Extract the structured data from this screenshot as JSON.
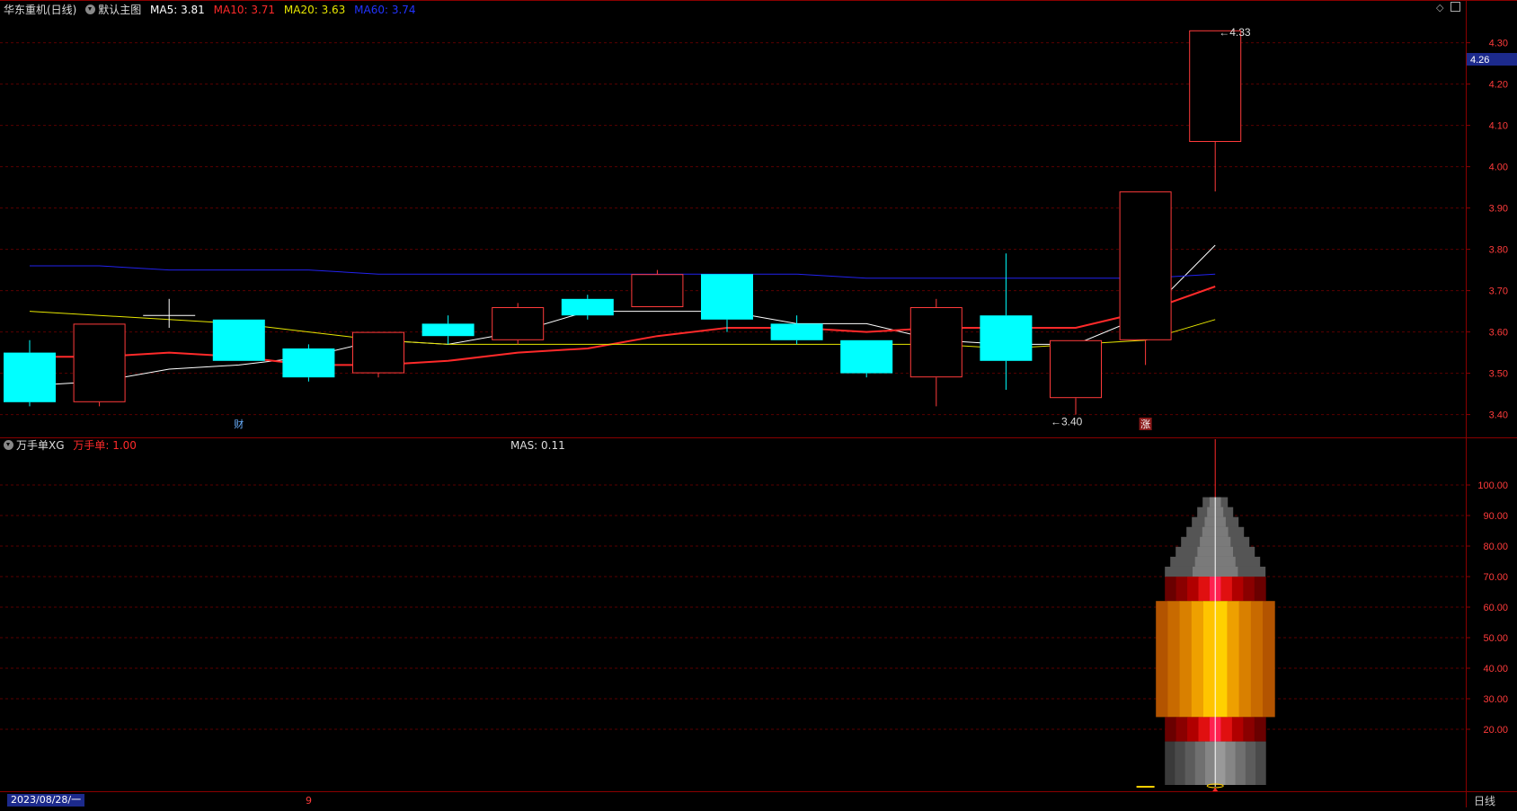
{
  "header": {
    "stock_name": "华东重机(日线)",
    "template_name": "默认主图",
    "ma5": {
      "label": "MA5: 3.81",
      "color": "#ffffff"
    },
    "ma10": {
      "label": "MA10: 3.71",
      "color": "#ff2a2a"
    },
    "ma20": {
      "label": "MA20: 3.63",
      "color": "#e6e600"
    },
    "ma60": {
      "label": "MA60: 3.74",
      "color": "#2222ee"
    }
  },
  "sub_header": {
    "indicator_name": "万手单XG",
    "value_label": "万手单: 1.00",
    "mas_label": "MAS: 0.11"
  },
  "footer": {
    "date_label": "2023/08/28/一",
    "month_marker": "9",
    "period_tab": "日线"
  },
  "colors": {
    "up": "#ff3b3b",
    "down": "#00ffff",
    "grid": "#5a0000",
    "axis_text": "#ff3b3b",
    "current_price_bg": "#1c2a8c"
  },
  "chart_data": [
    {
      "type": "candlestick",
      "title": "华东重机(日线)",
      "ylim": [
        3.36,
        4.36
      ],
      "y_ticks": [
        "4.30",
        "4.20",
        "4.10",
        "4.00",
        "3.90",
        "3.80",
        "3.70",
        "3.60",
        "3.50",
        "3.40"
      ],
      "current_price": "4.26",
      "candles": [
        {
          "o": 3.55,
          "h": 3.58,
          "l": 3.42,
          "c": 3.43
        },
        {
          "o": 3.43,
          "h": 3.62,
          "l": 3.42,
          "c": 3.62
        },
        {
          "o": 3.64,
          "h": 3.68,
          "l": 3.61,
          "c": 3.64
        },
        {
          "o": 3.63,
          "h": 3.63,
          "l": 3.53,
          "c": 3.53
        },
        {
          "o": 3.56,
          "h": 3.57,
          "l": 3.48,
          "c": 3.49
        },
        {
          "o": 3.5,
          "h": 3.6,
          "l": 3.49,
          "c": 3.6
        },
        {
          "o": 3.62,
          "h": 3.64,
          "l": 3.57,
          "c": 3.59
        },
        {
          "o": 3.58,
          "h": 3.67,
          "l": 3.57,
          "c": 3.66
        },
        {
          "o": 3.68,
          "h": 3.69,
          "l": 3.63,
          "c": 3.64
        },
        {
          "o": 3.66,
          "h": 3.75,
          "l": 3.66,
          "c": 3.74
        },
        {
          "o": 3.74,
          "h": 3.74,
          "l": 3.6,
          "c": 3.63
        },
        {
          "o": 3.62,
          "h": 3.64,
          "l": 3.57,
          "c": 3.58
        },
        {
          "o": 3.58,
          "h": 3.58,
          "l": 3.49,
          "c": 3.5
        },
        {
          "o": 3.49,
          "h": 3.68,
          "l": 3.42,
          "c": 3.66
        },
        {
          "o": 3.64,
          "h": 3.79,
          "l": 3.46,
          "c": 3.53
        },
        {
          "o": 3.44,
          "h": 3.58,
          "l": 3.4,
          "c": 3.58
        },
        {
          "o": 3.58,
          "h": 3.94,
          "l": 3.52,
          "c": 3.94
        },
        {
          "o": 4.06,
          "h": 4.33,
          "l": 3.94,
          "c": 4.33
        }
      ],
      "series": [
        {
          "name": "MA5",
          "color": "#ffffff",
          "values": [
            3.47,
            3.48,
            3.51,
            3.52,
            3.54,
            3.58,
            3.57,
            3.6,
            3.65,
            3.65,
            3.65,
            3.62,
            3.62,
            3.58,
            3.57,
            3.57,
            3.64,
            3.81
          ]
        },
        {
          "name": "MA10",
          "color": "#ff2a2a",
          "values": [
            3.54,
            3.54,
            3.55,
            3.54,
            3.52,
            3.52,
            3.53,
            3.55,
            3.56,
            3.59,
            3.61,
            3.61,
            3.6,
            3.61,
            3.61,
            3.61,
            3.65,
            3.71
          ]
        },
        {
          "name": "MA20",
          "color": "#e6e600",
          "values": [
            3.65,
            3.64,
            3.63,
            3.62,
            3.6,
            3.58,
            3.57,
            3.57,
            3.57,
            3.57,
            3.57,
            3.57,
            3.57,
            3.57,
            3.56,
            3.57,
            3.58,
            3.63
          ]
        },
        {
          "name": "MA60",
          "color": "#2222ee",
          "values": [
            3.76,
            3.76,
            3.75,
            3.75,
            3.75,
            3.74,
            3.74,
            3.74,
            3.74,
            3.74,
            3.74,
            3.74,
            3.73,
            3.73,
            3.73,
            3.73,
            3.73,
            3.74
          ]
        }
      ],
      "annotations": [
        {
          "candle": 17,
          "price": 4.33,
          "text": "4.33"
        },
        {
          "candle": 15,
          "price": 3.4,
          "text": "3.40"
        }
      ],
      "event_markers": [
        {
          "candle": 3,
          "text": "财",
          "color": "#6ab0ff"
        },
        {
          "candle": 16,
          "text": "涨",
          "color": "#ffffff",
          "bg": "#8a1a1a"
        }
      ]
    },
    {
      "type": "bar",
      "title": "万手单XG",
      "ylim": [
        0,
        115
      ],
      "y_ticks": [
        "100.00",
        "90.00",
        "80.00",
        "70.00",
        "60.00",
        "50.00",
        "40.00",
        "30.00",
        "20.00"
      ],
      "signal_candle": 17,
      "signal_value": 115,
      "rocket_top_value": 96,
      "small_marks": [
        {
          "candle": 16,
          "value": 0
        }
      ]
    }
  ]
}
